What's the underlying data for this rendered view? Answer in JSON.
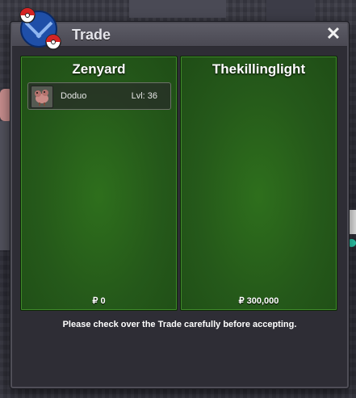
{
  "dialog": {
    "title": "Trade",
    "close_icon": "close-icon",
    "notice": "Please check over the Trade carefully before accepting."
  },
  "left_panel": {
    "player": "Zenyard",
    "money": "₽ 0",
    "items": [
      {
        "name": "Doduo",
        "level": "Lvl: 36",
        "icon": "doduo-sprite-icon"
      }
    ]
  },
  "right_panel": {
    "player": "Thekillinglight",
    "money": "₽ 300,000",
    "items": []
  },
  "colors": {
    "panel_green": "#2e6f1c",
    "dialog_bg": "#2e2d35",
    "titlebar": "#5d5c66"
  }
}
